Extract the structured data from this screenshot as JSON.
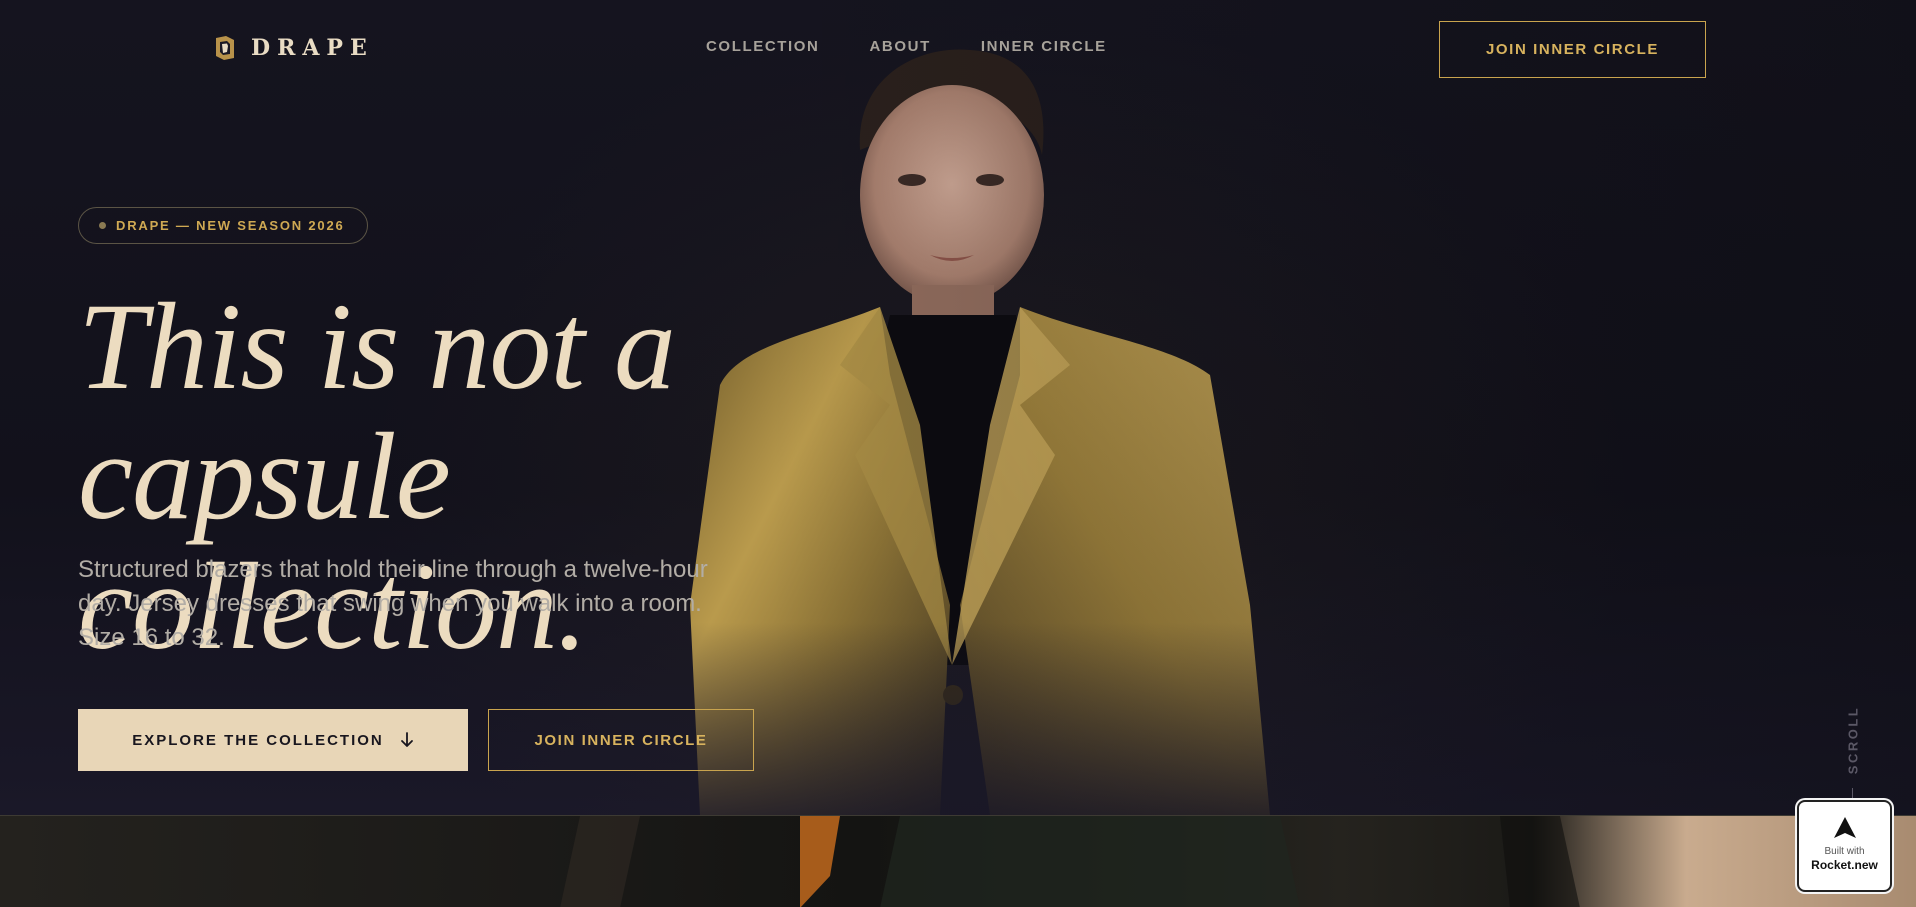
{
  "brand": {
    "name": "DRAPE"
  },
  "nav": {
    "links": [
      "COLLECTION",
      "ABOUT",
      "INNER CIRCLE"
    ],
    "cta": "JOIN INNER CIRCLE"
  },
  "hero": {
    "badge": "DRAPE — NEW SEASON 2026",
    "headline_line1": "This is not a",
    "headline_line2": "capsule collection.",
    "subcopy": "Structured blazers that hold their line through a twelve-hour day. Jersey dresses that swing when you walk into a room. Size 16 to 32.",
    "primary_button": "EXPLORE THE COLLECTION",
    "secondary_button": "JOIN INNER CIRCLE",
    "scroll_label": "SCROLL"
  },
  "built_badge": {
    "line1": "Built with",
    "line2": "Rocket.new"
  },
  "colors": {
    "background": "#13121c",
    "gold": "#d8b35e",
    "cream": "#ecdcc0",
    "button_fill": "#e8d6b7"
  },
  "icons": {
    "logo": "drape-logo-icon",
    "arrow": "arrow-down-icon",
    "rocket": "rocket-icon"
  }
}
